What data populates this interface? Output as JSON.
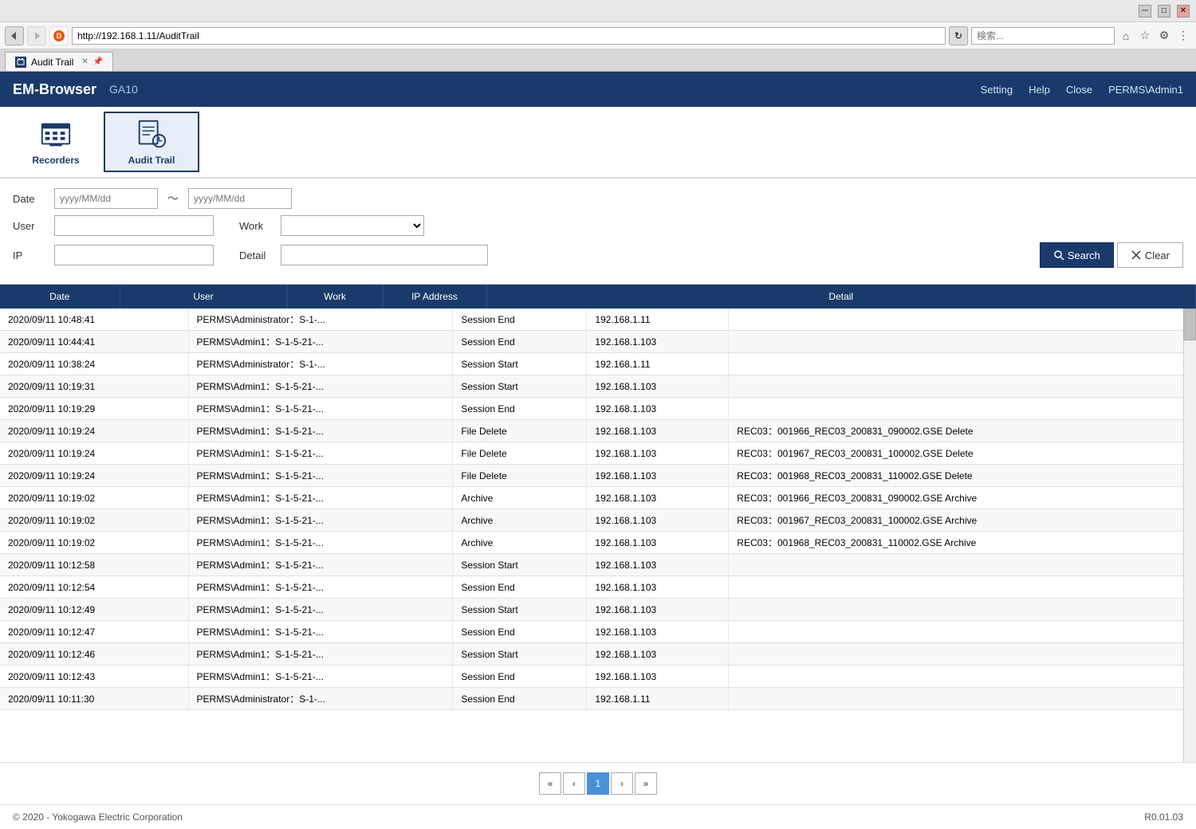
{
  "browser": {
    "url": "http://192.168.1.11/AuditTrail",
    "search_placeholder": "検索...",
    "tab_title": "Audit Trail",
    "titlebar_buttons": [
      "─",
      "□",
      "✕"
    ]
  },
  "header": {
    "app_name": "EM-Browser",
    "subtitle": "GA10",
    "nav": [
      "Setting",
      "Help",
      "Close",
      "PERMS\\Admin1"
    ]
  },
  "icons": [
    {
      "id": "recorders",
      "label": "Recorders",
      "active": false
    },
    {
      "id": "audit-trail",
      "label": "Audit Trail",
      "active": true
    }
  ],
  "filters": {
    "date_label": "Date",
    "date_from_placeholder": "yyyy/MM/dd",
    "date_to_placeholder": "yyyy/MM/dd",
    "tilde": "～",
    "user_label": "User",
    "work_label": "Work",
    "ip_label": "IP",
    "detail_label": "Detail",
    "search_btn": "Search",
    "clear_btn": "Clear"
  },
  "table": {
    "headers": [
      "Date",
      "User",
      "Work",
      "IP Address",
      "Detail"
    ],
    "rows": [
      {
        "date": "2020/09/11 10:48:41",
        "user": "PERMS\\Administrator：S-1-...",
        "work": "Session End",
        "ip": "192.168.1.11",
        "detail": ""
      },
      {
        "date": "2020/09/11 10:44:41",
        "user": "PERMS\\Admin1：S-1-5-21-...",
        "work": "Session End",
        "ip": "192.168.1.103",
        "detail": ""
      },
      {
        "date": "2020/09/11 10:38:24",
        "user": "PERMS\\Administrator：S-1-...",
        "work": "Session Start",
        "ip": "192.168.1.11",
        "detail": ""
      },
      {
        "date": "2020/09/11 10:19:31",
        "user": "PERMS\\Admin1：S-1-5-21-...",
        "work": "Session Start",
        "ip": "192.168.1.103",
        "detail": ""
      },
      {
        "date": "2020/09/11 10:19:29",
        "user": "PERMS\\Admin1：S-1-5-21-...",
        "work": "Session End",
        "ip": "192.168.1.103",
        "detail": ""
      },
      {
        "date": "2020/09/11 10:19:24",
        "user": "PERMS\\Admin1：S-1-5-21-...",
        "work": "File Delete",
        "ip": "192.168.1.103",
        "detail": "REC03：001966_REC03_200831_090002.GSE Delete"
      },
      {
        "date": "2020/09/11 10:19:24",
        "user": "PERMS\\Admin1：S-1-5-21-...",
        "work": "File Delete",
        "ip": "192.168.1.103",
        "detail": "REC03：001967_REC03_200831_100002.GSE Delete"
      },
      {
        "date": "2020/09/11 10:19:24",
        "user": "PERMS\\Admin1：S-1-5-21-...",
        "work": "File Delete",
        "ip": "192.168.1.103",
        "detail": "REC03：001968_REC03_200831_110002.GSE Delete"
      },
      {
        "date": "2020/09/11 10:19:02",
        "user": "PERMS\\Admin1：S-1-5-21-...",
        "work": "Archive",
        "ip": "192.168.1.103",
        "detail": "REC03：001966_REC03_200831_090002.GSE Archive"
      },
      {
        "date": "2020/09/11 10:19:02",
        "user": "PERMS\\Admin1：S-1-5-21-...",
        "work": "Archive",
        "ip": "192.168.1.103",
        "detail": "REC03：001967_REC03_200831_100002.GSE Archive"
      },
      {
        "date": "2020/09/11 10:19:02",
        "user": "PERMS\\Admin1：S-1-5-21-...",
        "work": "Archive",
        "ip": "192.168.1.103",
        "detail": "REC03：001968_REC03_200831_110002.GSE Archive"
      },
      {
        "date": "2020/09/11 10:12:58",
        "user": "PERMS\\Admin1：S-1-5-21-...",
        "work": "Session Start",
        "ip": "192.168.1.103",
        "detail": ""
      },
      {
        "date": "2020/09/11 10:12:54",
        "user": "PERMS\\Admin1：S-1-5-21-...",
        "work": "Session End",
        "ip": "192.168.1.103",
        "detail": ""
      },
      {
        "date": "2020/09/11 10:12:49",
        "user": "PERMS\\Admin1：S-1-5-21-...",
        "work": "Session Start",
        "ip": "192.168.1.103",
        "detail": ""
      },
      {
        "date": "2020/09/11 10:12:47",
        "user": "PERMS\\Admin1：S-1-5-21-...",
        "work": "Session End",
        "ip": "192.168.1.103",
        "detail": ""
      },
      {
        "date": "2020/09/11 10:12:46",
        "user": "PERMS\\Admin1：S-1-5-21-...",
        "work": "Session Start",
        "ip": "192.168.1.103",
        "detail": ""
      },
      {
        "date": "2020/09/11 10:12:43",
        "user": "PERMS\\Admin1：S-1-5-21-...",
        "work": "Session End",
        "ip": "192.168.1.103",
        "detail": ""
      },
      {
        "date": "2020/09/11 10:11:30",
        "user": "PERMS\\Administrator：S-1-...",
        "work": "Session End",
        "ip": "192.168.1.11",
        "detail": ""
      }
    ]
  },
  "pagination": {
    "first": "«",
    "prev": "‹",
    "current": "1",
    "next": "›",
    "last": "»"
  },
  "footer": {
    "copyright": "© 2020 - Yokogawa Electric Corporation",
    "version": "R0.01.03"
  }
}
